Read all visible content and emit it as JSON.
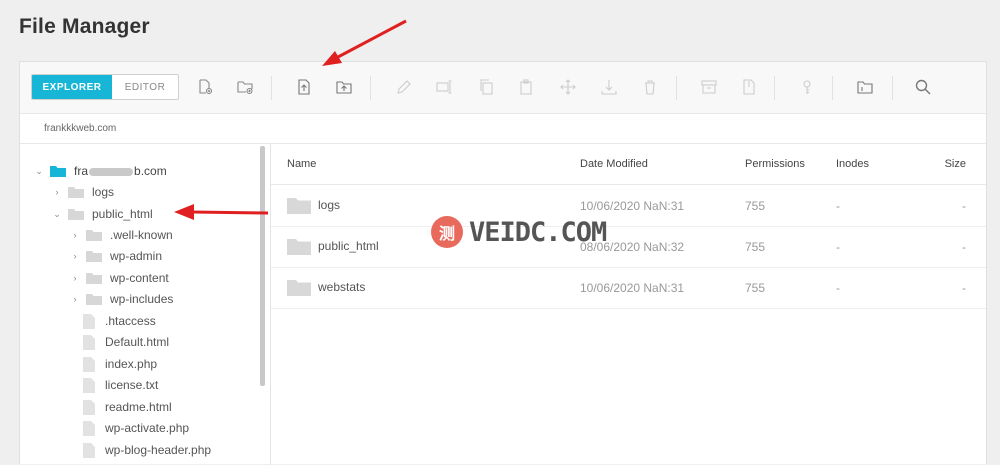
{
  "title": "File Manager",
  "tabs": {
    "explorer": "EXPLORER",
    "editor": "EDITOR"
  },
  "path": "frankkkweb.com",
  "tree": {
    "root": {
      "prefix": "fra",
      "suffix": "b.com"
    },
    "items": [
      {
        "label": "logs"
      },
      {
        "label": "public_html"
      },
      {
        "label": ".well-known"
      },
      {
        "label": "wp-admin"
      },
      {
        "label": "wp-content"
      },
      {
        "label": "wp-includes"
      },
      {
        "label": ".htaccess"
      },
      {
        "label": "Default.html"
      },
      {
        "label": "index.php"
      },
      {
        "label": "license.txt"
      },
      {
        "label": "readme.html"
      },
      {
        "label": "wp-activate.php"
      },
      {
        "label": "wp-blog-header.php"
      }
    ]
  },
  "table": {
    "headers": {
      "name": "Name",
      "date": "Date Modified",
      "perm": "Permissions",
      "inodes": "Inodes",
      "size": "Size"
    },
    "rows": [
      {
        "name": "logs",
        "date": "10/06/2020 NaN:31",
        "perm": "755",
        "inodes": "-",
        "size": "-"
      },
      {
        "name": "public_html",
        "date": "08/06/2020 NaN:32",
        "perm": "755",
        "inodes": "-",
        "size": "-"
      },
      {
        "name": "webstats",
        "date": "10/06/2020 NaN:31",
        "perm": "755",
        "inodes": "-",
        "size": "-"
      }
    ]
  },
  "watermark": {
    "logo": "测",
    "text": "VEIDC.COM"
  },
  "colors": {
    "accent": "#18b6d6",
    "annotation": "#e02020"
  },
  "icons": [
    "new-file-icon",
    "new-folder-icon",
    "upload-file-icon",
    "upload-folder-icon",
    "edit-icon",
    "rename-icon",
    "copy-icon",
    "paste-icon",
    "move-icon",
    "download-icon",
    "delete-icon",
    "archive-icon",
    "extract-icon",
    "permissions-icon",
    "properties-icon",
    "search-icon"
  ]
}
